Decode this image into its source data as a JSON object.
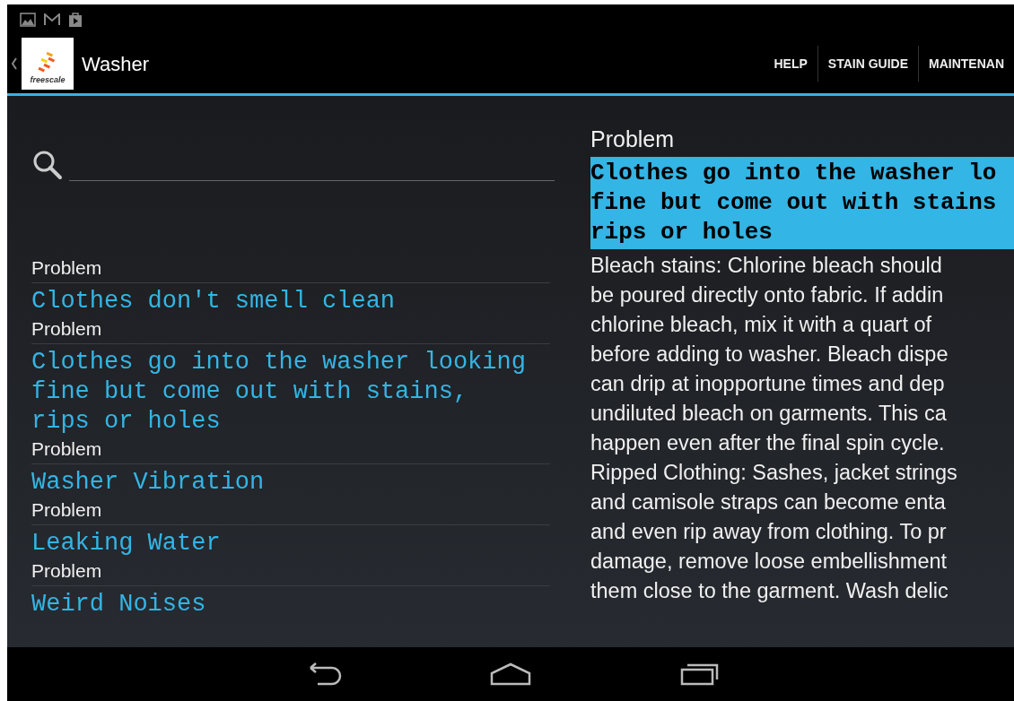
{
  "app_bar": {
    "title": "Washer",
    "logo_text": "freescale",
    "tabs": [
      {
        "label": "HELP"
      },
      {
        "label": "STAIN GUIDE"
      },
      {
        "label": "MAINTENAN"
      }
    ]
  },
  "list": {
    "rows": [
      {
        "kind": "subtitle",
        "text": "Problem"
      },
      {
        "kind": "title",
        "text": "Clothes don't smell clean"
      },
      {
        "kind": "subtitle",
        "text": "Problem"
      },
      {
        "kind": "title",
        "text": "Clothes go into the washer looking fine but come out with stains, rips or holes"
      },
      {
        "kind": "subtitle",
        "text": "Problem"
      },
      {
        "kind": "title",
        "text": "Washer Vibration"
      },
      {
        "kind": "subtitle",
        "text": "Problem"
      },
      {
        "kind": "title",
        "text": "Leaking Water"
      },
      {
        "kind": "subtitle",
        "text": "Problem"
      },
      {
        "kind": "title",
        "text": "Weird Noises"
      }
    ]
  },
  "detail": {
    "heading": "Problem",
    "title_lines": [
      "Clothes go into the washer lo",
      "fine but come out with stains",
      "rips or holes"
    ],
    "body_lines": [
      "Bleach stains: Chlorine bleach should",
      "be poured directly onto fabric. If addin",
      "chlorine bleach, mix it with a quart of",
      "before adding to washer. Bleach dispe",
      "can drip at inopportune times and dep",
      "undiluted bleach on garments. This ca",
      "happen even after the final spin cycle.",
      "Ripped Clothing: Sashes, jacket strings",
      "and camisole straps can become enta",
      "and even rip away from clothing. To pr",
      "damage, remove loose embellishment",
      "them close to the garment. Wash delic"
    ]
  }
}
